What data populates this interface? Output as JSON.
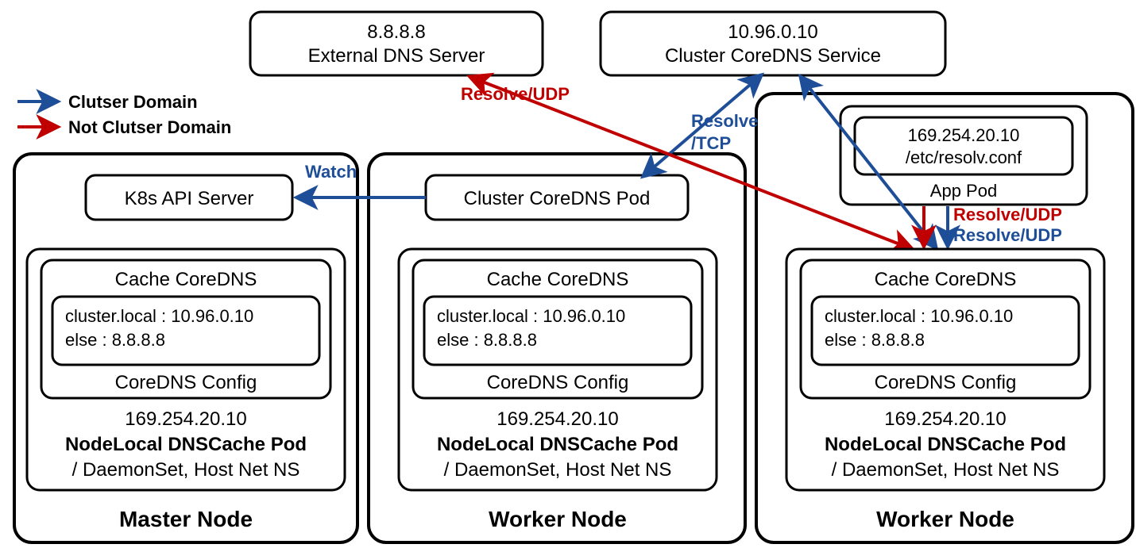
{
  "legend": {
    "cluster": "Clutser Domain",
    "not_cluster": "Not Clutser Domain"
  },
  "top": {
    "ext_dns_ip": "8.8.8.8",
    "ext_dns_name": "External DNS Server",
    "coredns_svc_ip": "10.96.0.10",
    "coredns_svc_name": "Cluster CoreDNS Service"
  },
  "labels": {
    "watch": "Watch",
    "resolve_tcp": "Resolve",
    "resolve_tcp2": "/TCP",
    "resolve_udp": "Resolve/UDP"
  },
  "app_pod": {
    "resolv_ip": "169.254.20.10",
    "resolv_file": "/etc/resolv.conf",
    "name": "App Pod"
  },
  "pods": {
    "api_server": "K8s API Server",
    "coredns_pod": "Cluster CoreDNS Pod"
  },
  "cache": {
    "title": "Cache CoreDNS",
    "rule1": "cluster.local : 10.96.0.10",
    "rule2": "else : 8.8.8.8",
    "config": "CoreDNS Config",
    "ip": "169.254.20.10",
    "pod_name": "NodeLocal DNSCache Pod",
    "ds": "/ DaemonSet, Host Net NS"
  },
  "nodes": {
    "master": "Master Node",
    "worker": "Worker Node"
  }
}
